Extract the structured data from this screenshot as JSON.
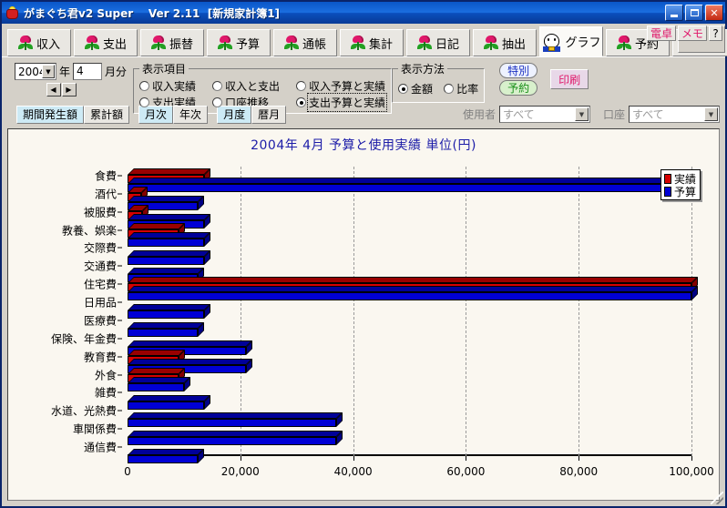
{
  "window": {
    "title": "がまぐち君v2 Super    Ver 2.11  [新規家計簿1]",
    "app_icon": "purse-icon",
    "minimize": "–",
    "maximize": "❐",
    "close": "✕"
  },
  "tabs": [
    {
      "label": "収入",
      "icon": "tulip-icon",
      "active": false
    },
    {
      "label": "支出",
      "icon": "tulip-icon",
      "active": false
    },
    {
      "label": "振替",
      "icon": "tulip-icon",
      "active": false
    },
    {
      "label": "予算",
      "icon": "tulip-icon",
      "active": false
    },
    {
      "label": "通帳",
      "icon": "tulip-icon",
      "active": false
    },
    {
      "label": "集計",
      "icon": "tulip-icon",
      "active": false
    },
    {
      "label": "日記",
      "icon": "tulip-icon",
      "active": false
    },
    {
      "label": "抽出",
      "icon": "tulip-icon",
      "active": false
    },
    {
      "label": "グラフ",
      "icon": "cat-icon",
      "active": true
    },
    {
      "label": "予約",
      "icon": "tulip-icon",
      "active": false
    },
    {
      "label": "管理",
      "icon": "tulip-icon",
      "active": false
    }
  ],
  "topright": {
    "calculator": "電卓",
    "memo": "メモ",
    "help": "?"
  },
  "date_selector": {
    "year_value": "2004",
    "year_suffix": "年",
    "month_value": "4",
    "month_suffix": "月分",
    "prev": "◀",
    "next": "▶"
  },
  "display_items": {
    "legend": "表示項目",
    "options": [
      {
        "label": "収入実績",
        "selected": false
      },
      {
        "label": "収入と支出",
        "selected": false
      },
      {
        "label": "収入予算と実績",
        "selected": false
      },
      {
        "label": "支出実績",
        "selected": false
      },
      {
        "label": "口座推移",
        "selected": false
      },
      {
        "label": "支出予算と実績",
        "selected": true
      }
    ]
  },
  "display_method": {
    "legend": "表示方法",
    "options": [
      {
        "label": "金額",
        "selected": true
      },
      {
        "label": "比率",
        "selected": false
      }
    ]
  },
  "action_buttons": {
    "special": "特別",
    "reserve": "予約",
    "print": "印刷"
  },
  "filter_row": {
    "segments_a": [
      {
        "label": "期間発生額",
        "active": true
      },
      {
        "label": "累計額",
        "active": false
      }
    ],
    "segments_b": [
      {
        "label": "月次",
        "active": true
      },
      {
        "label": "年次",
        "active": false
      }
    ],
    "segments_c": [
      {
        "label": "月度",
        "active": true
      },
      {
        "label": "暦月",
        "active": false
      }
    ],
    "user_label": "使用者",
    "user_value": "すべて",
    "account_label": "口座",
    "account_value": "すべて",
    "dropdown_arrow": "▼"
  },
  "chart_data": {
    "type": "bar",
    "orientation": "horizontal",
    "title": "2004年 4月 予算と使用実績 単位(円)",
    "xlabel": "",
    "ylabel": "",
    "xlim": [
      0,
      100000
    ],
    "xticks": [
      0,
      20000,
      40000,
      60000,
      80000,
      100000
    ],
    "xticklabels": [
      "0",
      "20,000",
      "40,000",
      "60,000",
      "80,000",
      "100,000"
    ],
    "grid": true,
    "legend_position": "top-right",
    "categories": [
      "食費",
      "酒代",
      "被服費",
      "教養、娯楽",
      "交際費",
      "交通費",
      "住宅費",
      "日用品",
      "医療費",
      "保険、年金費",
      "教育費",
      "外食",
      "雑費",
      "水道、光熱費",
      "車関係費",
      "通信費"
    ],
    "series": [
      {
        "name": "実績",
        "color": "#d50000",
        "values": [
          13500,
          2500,
          2600,
          9000,
          0,
          0,
          100000,
          0,
          0,
          0,
          9000,
          9000,
          0,
          0,
          0,
          0
        ]
      },
      {
        "name": "予算",
        "color": "#0000d5",
        "values": [
          100000,
          12500,
          13500,
          13500,
          13500,
          12500,
          100000,
          13500,
          12500,
          21000,
          21000,
          10000,
          13500,
          37000,
          37000,
          12500
        ]
      }
    ]
  }
}
